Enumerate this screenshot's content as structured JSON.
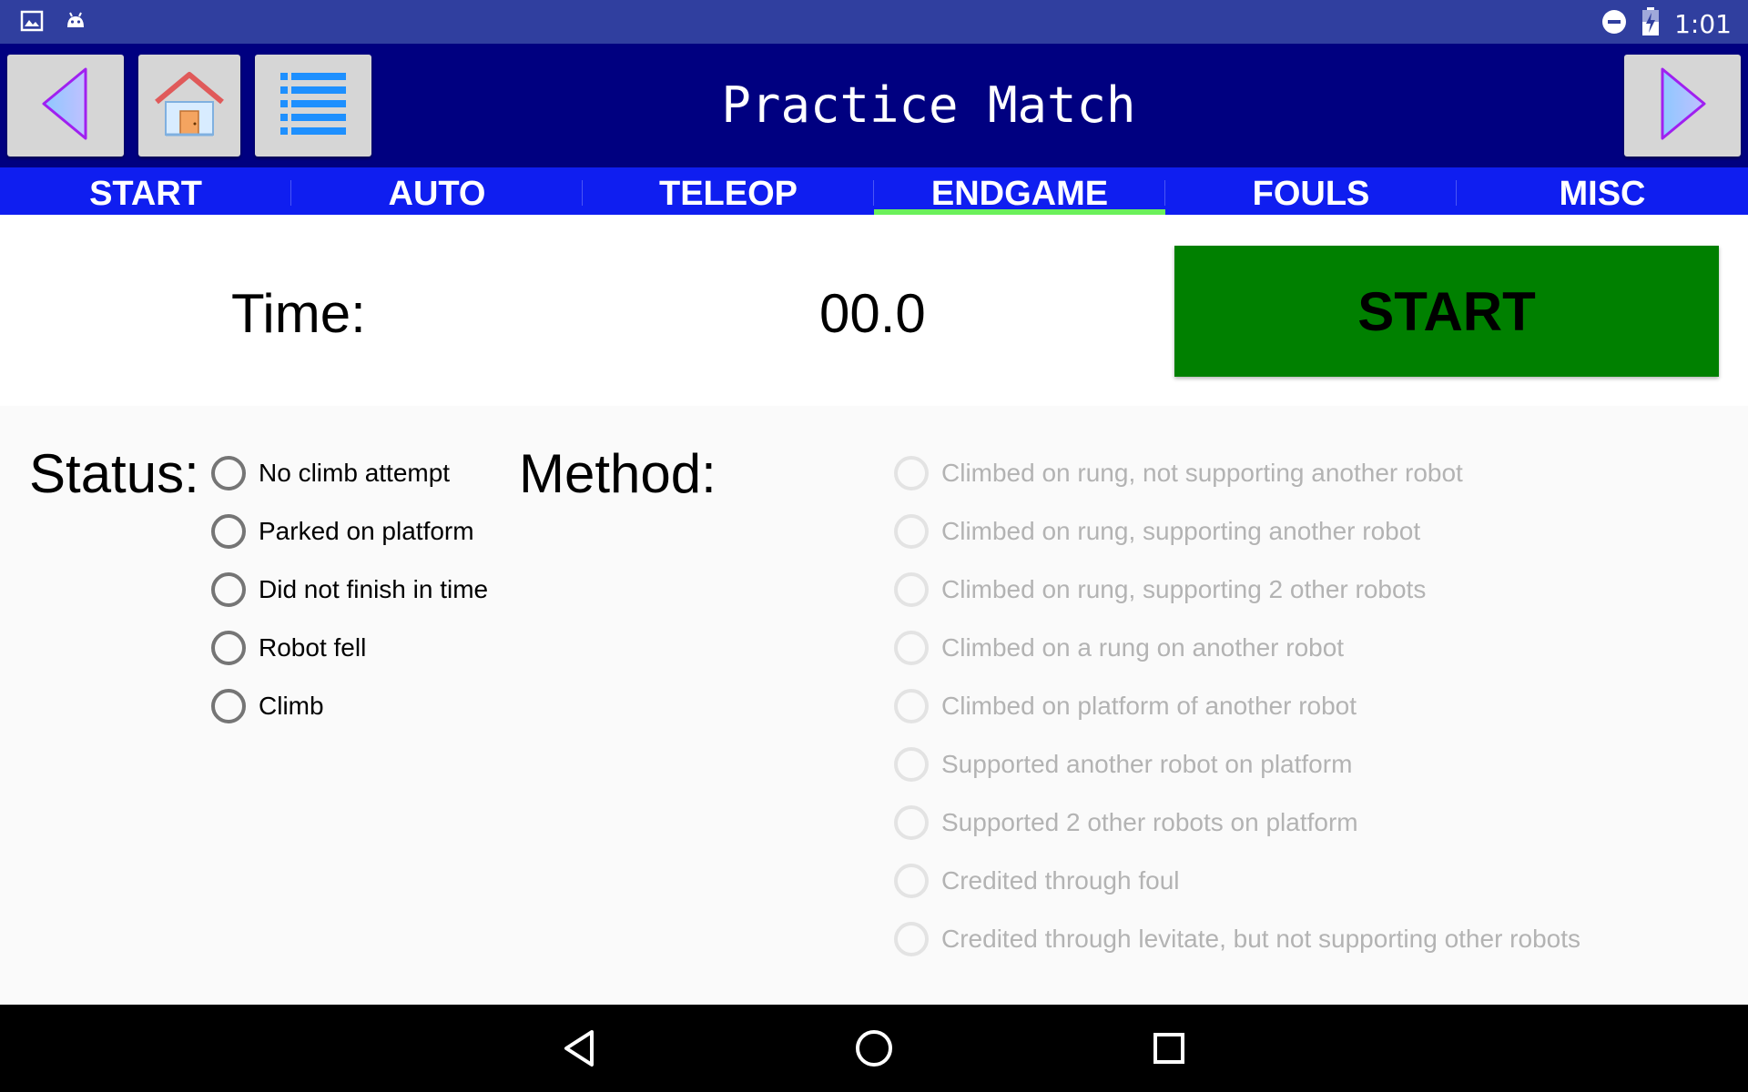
{
  "status_bar": {
    "time": "1:01",
    "icons": [
      "gallery-icon",
      "android-icon",
      "do-not-disturb-icon",
      "battery-charging-icon"
    ]
  },
  "toolbar": {
    "title": "Practice Match",
    "back_icon": "left-triangle-icon",
    "home_icon": "home-icon",
    "list_icon": "list-icon",
    "forward_icon": "right-triangle-icon"
  },
  "tabs": [
    {
      "label": "START",
      "active": false
    },
    {
      "label": "AUTO",
      "active": false
    },
    {
      "label": "TELEOP",
      "active": false
    },
    {
      "label": "ENDGAME",
      "active": true
    },
    {
      "label": "FOULS",
      "active": false
    },
    {
      "label": "MISC",
      "active": false
    }
  ],
  "timer": {
    "label": "Time:",
    "value": "00.0",
    "start_button": "START"
  },
  "status": {
    "label": "Status:",
    "options": [
      "No climb attempt",
      "Parked on platform",
      "Did not finish in time",
      "Robot fell",
      "Climb"
    ]
  },
  "method": {
    "label": "Method:",
    "options": [
      "Climbed on rung, not supporting another robot",
      "Climbed on rung, supporting another robot",
      "Climbed on rung, supporting 2 other robots",
      "Climbed on a rung on another robot",
      "Climbed on platform of another robot",
      "Supported another robot on platform",
      "Supported 2 other robots on platform",
      "Credited through foul",
      "Credited through levitate, but not supporting other robots"
    ]
  },
  "colors": {
    "status_bar": "#303f9f",
    "toolbar": "#000080",
    "tabs": "#0f1ef0",
    "tab_indicator": "#6bf05a",
    "start_button": "#008000"
  },
  "nav_bar": {
    "icons": [
      "back-icon",
      "home-circle-icon",
      "recents-icon"
    ]
  }
}
